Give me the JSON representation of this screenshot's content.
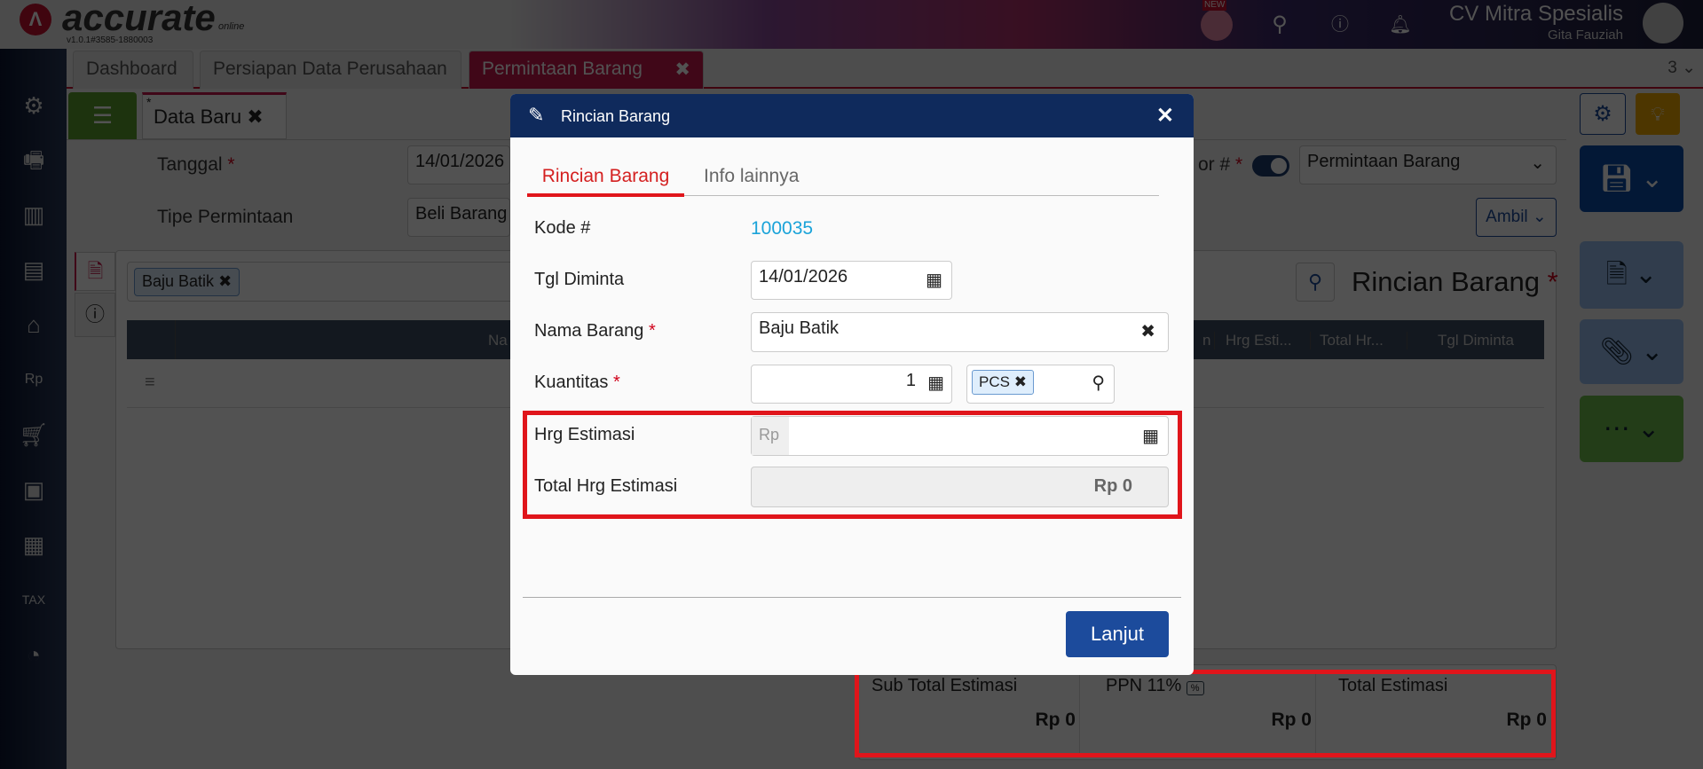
{
  "header": {
    "brand": "accurate",
    "brand_sub": "online",
    "version": "v1.0.1#3585-1880003",
    "new_badge": "NEW",
    "company": "CV Mitra Spesialis",
    "user": "Gita Fauziah"
  },
  "tabs": [
    {
      "label": "Dashboard"
    },
    {
      "label": "Persiapan Data Perusahaan"
    },
    {
      "label": "Permintaan Barang",
      "active": true
    }
  ],
  "tab_count": "3",
  "form": {
    "subtab": "Data Baru",
    "subtab_modified": "*",
    "tanggal_label": "Tanggal",
    "tanggal_value": "14/01/2026",
    "tipe_label": "Tipe Permintaan",
    "tipe_value": "Beli Barang",
    "nomor_label": "or #",
    "nomor_select": "Permintaan Barang",
    "ambil": "Ambil"
  },
  "detail": {
    "chip": "Baju Batik",
    "title": "Rincian Barang",
    "columns": [
      "Na",
      "n",
      "Hrg Esti...",
      "Total Hr...",
      "Tgl Diminta"
    ]
  },
  "totals": {
    "subtotal_label": "Sub Total Estimasi",
    "subtotal_value": "Rp 0",
    "ppn_label": "PPN 11%",
    "ppn_badge": "%",
    "ppn_value": "Rp 0",
    "total_label": "Total Estimasi",
    "total_value": "Rp 0"
  },
  "modal": {
    "title": "Rincian Barang",
    "tabs": [
      "Rincian Barang",
      "Info lainnya"
    ],
    "kode_label": "Kode #",
    "kode_value": "100035",
    "tgl_label": "Tgl Diminta",
    "tgl_value": "14/01/2026",
    "nama_label": "Nama Barang",
    "nama_value": "Baju Batik",
    "qty_label": "Kuantitas",
    "qty_value": "1",
    "unit": "PCS",
    "hrg_label": "Hrg Estimasi",
    "hrg_prefix": "Rp",
    "hrg_value": "",
    "total_label": "Total Hrg Estimasi",
    "total_value": "Rp 0",
    "submit": "Lanjut"
  },
  "colors": {
    "accent": "#c8164a",
    "modal_header": "#0f2a5c",
    "primary": "#1c4b9c",
    "highlight": "#e0151b",
    "link": "#1aa3d9"
  }
}
